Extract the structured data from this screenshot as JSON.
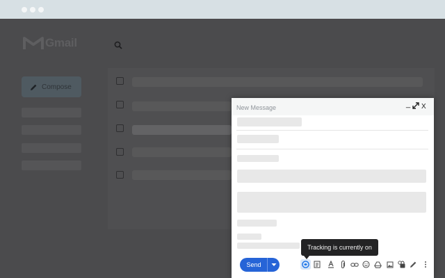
{
  "browser": {
    "dots": [
      "window-dot",
      "window-dot",
      "window-dot"
    ]
  },
  "gmail": {
    "logo_text": "Gmail",
    "search_icon": "search-icon",
    "compose_label": "Compose",
    "compose_icon": "pencil-icon"
  },
  "compose_window": {
    "title": "New Message",
    "minimize_label": "_",
    "expand_icon": "expand-icon",
    "close_label": "X",
    "send_label": "Send",
    "send_options_icon": "chevron-down-icon",
    "toolbar_icons": [
      "tracking-icon",
      "template-icon",
      "formatting-icon",
      "attachment-icon",
      "link-icon",
      "emoji-icon",
      "drive-icon",
      "photo-icon",
      "confidential-icon",
      "signature-icon",
      "more-options-icon"
    ]
  },
  "tooltip": {
    "text": "Tracking is currently on"
  },
  "colors": {
    "overlay": "#4a4a4c",
    "send": "#2664d7",
    "tooltip": "#232324",
    "tracking_active": "#1a73e8"
  }
}
